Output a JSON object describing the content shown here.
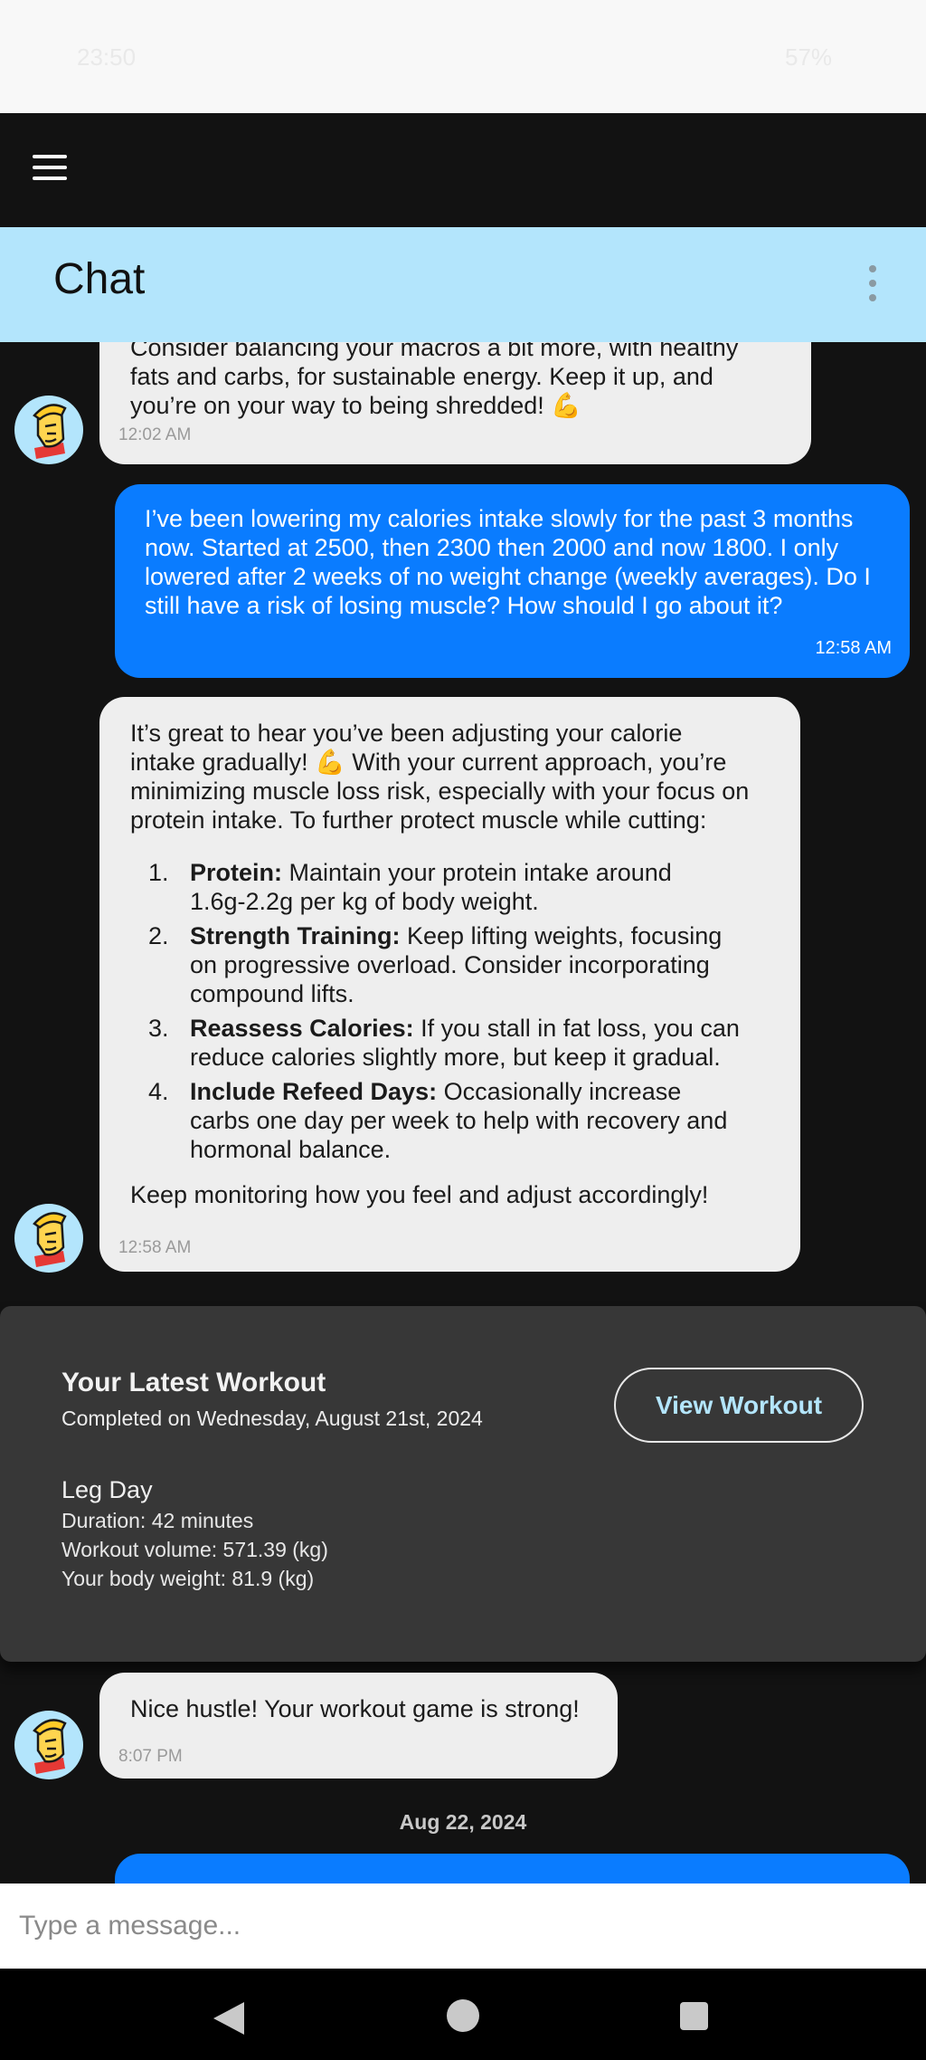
{
  "status_bar": {
    "time": "23:50",
    "battery": "57%"
  },
  "header": {
    "title": "Chat"
  },
  "messages": [
    {
      "sender": "bot",
      "lines": [
        "Consider balancing your macros a bit more, with healthy",
        "fats and carbs, for sustainable energy. Keep it up, and",
        "you’re on your way to being shredded! 💪"
      ],
      "time": "12:02 AM"
    },
    {
      "sender": "user",
      "lines": [
        "I’ve been lowering my calories intake slowly for the past 3 months",
        "now. Started at 2500, then 2300 then 2000 and now 1800. I only",
        "lowered after 2 weeks of no weight change (weekly averages). Do I",
        "still have a risk of losing muscle? How should I go about it?"
      ],
      "time": "12:58 AM"
    },
    {
      "sender": "bot",
      "intro_lines": [
        "It’s great to hear you’ve been adjusting your calorie",
        "intake gradually! 💪 With your current approach, you’re",
        "minimizing muscle loss risk, especially with your focus on",
        "protein intake. To further protect muscle while cutting:"
      ],
      "tips": [
        {
          "num": "1.",
          "title": "Protein:",
          "text": "Maintain your protein intake around",
          "cont": [
            "1.6g-2.2g per kg of body weight."
          ]
        },
        {
          "num": "2.",
          "title": "Strength Training:",
          "text": "Keep lifting weights, focusing",
          "cont": [
            "on progressive overload. Consider incorporating",
            "compound lifts."
          ]
        },
        {
          "num": "3.",
          "title": "Reassess Calories:",
          "text": "If you stall in fat loss, you can",
          "cont": [
            "reduce calories slightly more, but keep it gradual."
          ]
        },
        {
          "num": "4.",
          "title": "Include Refeed Days:",
          "text": "Occasionally increase",
          "cont": [
            "carbs one day per week to help with recovery and",
            "hormonal balance."
          ]
        }
      ],
      "outro": "Keep monitoring how you feel and adjust accordingly!",
      "time": "12:58 AM"
    },
    {
      "sender": "bot",
      "lines": [
        "Nice hustle! Your workout game is strong!"
      ],
      "time": "8:07 PM"
    }
  ],
  "workout_card": {
    "title": "Your Latest Workout",
    "completed": "Completed on Wednesday, August 21st, 2024",
    "button_label": "View Workout",
    "name": "Leg Day",
    "duration": "Duration: 42 minutes",
    "volume": "Workout volume: 571.39 (kg)",
    "body_weight": "Your body weight: 81.9 (kg)"
  },
  "date_separator": "Aug 22, 2024",
  "composer": {
    "placeholder": "Type a message..."
  },
  "colors": {
    "header_bg": "#b3e5fc",
    "user_bubble": "#0a7cff",
    "bot_bubble": "#eeeeee",
    "background": "#121212"
  }
}
